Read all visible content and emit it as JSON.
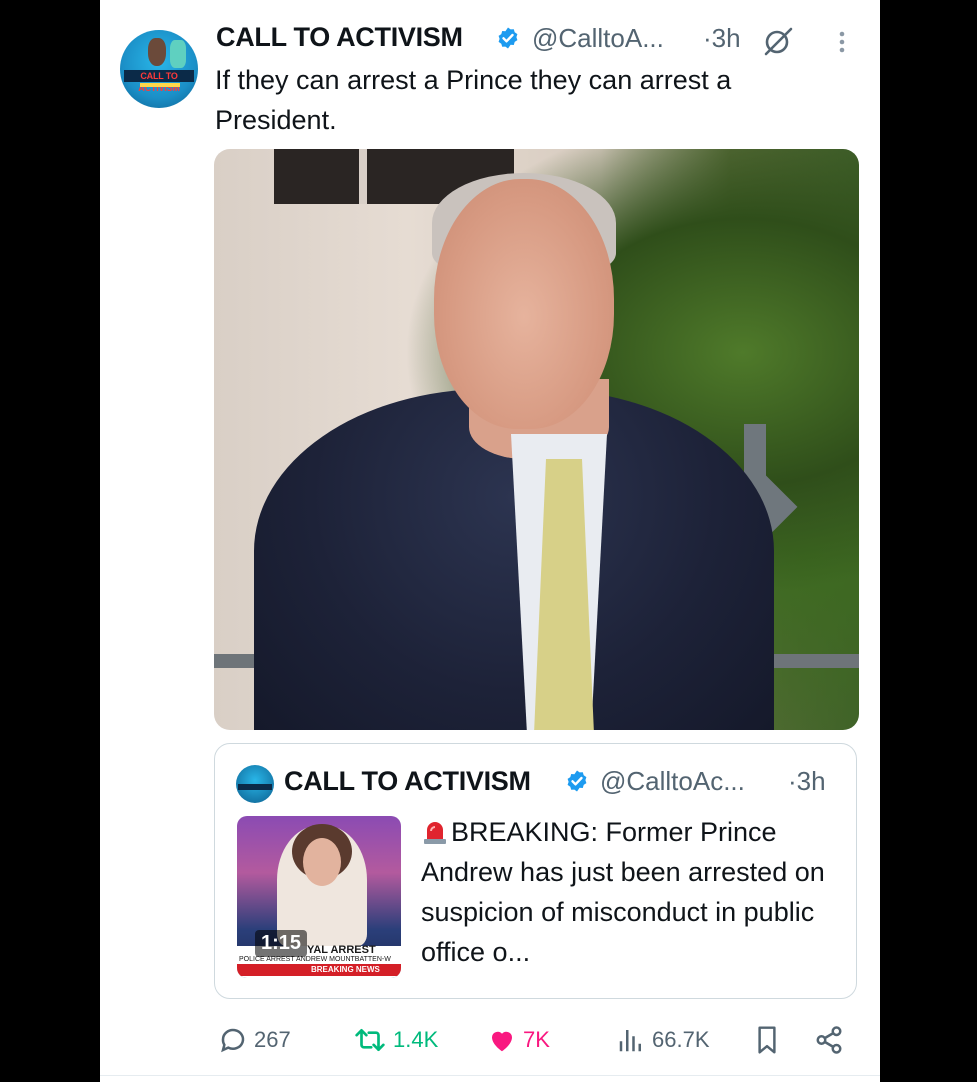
{
  "tweet": {
    "display_name": "CALL TO ACTIVISM",
    "handle": "@CalltoA...",
    "separator_time": "·3h",
    "text": "If they can arrest a Prince they can arrest a President."
  },
  "avatar_label": "CALL TO ACTIVISM",
  "quoted": {
    "display_name": "CALL TO ACTIVISM",
    "handle": "@CalltoAc...",
    "separator_time": "·3h",
    "text": "BREAKING: Former Prince Andrew has just been arrested on suspicion of misconduct in public office o...",
    "video": {
      "duration": "1:15",
      "lower_third_title": "YAL ARREST",
      "lower_third_sub": "POLICE ARREST ANDREW MOUNTBATTEN-W",
      "ticker": "BREAKING NEWS"
    }
  },
  "actions": {
    "replies": "267",
    "reposts": "1.4K",
    "likes": "7K",
    "views": "66.7K"
  },
  "colors": {
    "verified": "#1d9bf0",
    "repost": "#00ba7c",
    "like": "#f91880",
    "secondary_text": "#536471"
  },
  "icons": [
    "verified-badge-icon",
    "grok-icon",
    "more-icon",
    "siren-icon",
    "reply-icon",
    "repost-icon",
    "heart-icon",
    "views-icon",
    "bookmark-icon",
    "share-icon"
  ]
}
